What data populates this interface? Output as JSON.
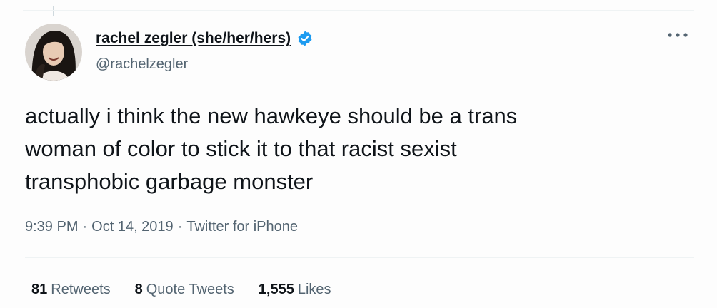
{
  "author": {
    "display_name": "rachel zegler (she/her/hers)",
    "handle": "@rachelzegler",
    "verified": true,
    "avatar_icon": "profile-photo"
  },
  "tweet": {
    "text": "actually i think the new hawkeye should be a trans\nwoman of color to stick it to that racist sexist\ntransphobic garbage monster",
    "time": "9:39 PM",
    "separator": "·",
    "date": "Oct 14, 2019",
    "source": "Twitter for iPhone"
  },
  "stats": {
    "retweets_count": "81",
    "retweets_label": "Retweets",
    "quotes_count": "8",
    "quotes_label": "Quote Tweets",
    "likes_count": "1,555",
    "likes_label": "Likes"
  },
  "colors": {
    "verified_badge": "#1d9bf0",
    "secondary_text": "#536471",
    "primary_text": "#0f1419"
  },
  "icons": {
    "more": "more-dots-icon",
    "verified": "verified-badge-icon"
  }
}
